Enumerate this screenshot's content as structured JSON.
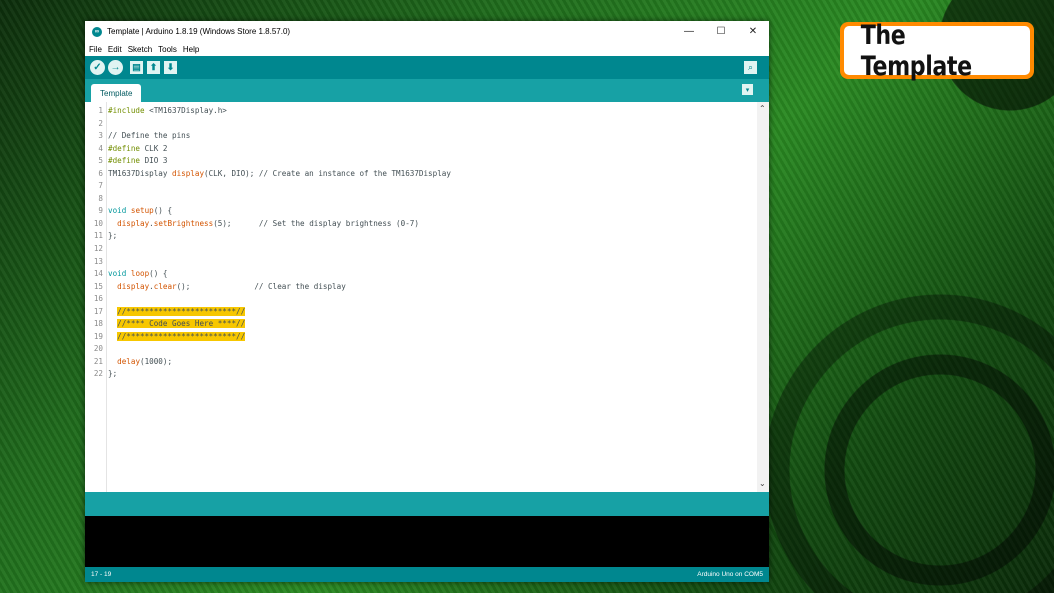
{
  "window": {
    "title": "Template | Arduino 1.8.19 (Windows Store 1.8.57.0)",
    "controls": {
      "minimize": "—",
      "maximize": "☐",
      "close": "✕"
    }
  },
  "menu": [
    "File",
    "Edit",
    "Sketch",
    "Tools",
    "Help"
  ],
  "toolbar": {
    "verify_glyph": "✓",
    "upload_glyph": "→",
    "new_glyph": "▤",
    "open_glyph": "⬆",
    "save_glyph": "⬇",
    "serial_glyph": "⌕"
  },
  "tabs": [
    {
      "label": "Template"
    }
  ],
  "tab_menu_glyph": "▾",
  "code_lines": [
    "1",
    "2",
    "3",
    "4",
    "5",
    "6",
    "7",
    "8",
    "9",
    "10",
    "11",
    "12",
    "13",
    "14",
    "15",
    "16",
    "17",
    "18",
    "19",
    "20",
    "21",
    "22"
  ],
  "code": {
    "l1a": "#include",
    "l1b": " <TM1637Display.h>",
    "l3": "// Define the pins",
    "l4a": "#define",
    "l4b": " CLK 2",
    "l5a": "#define",
    "l5b": " DIO 3",
    "l6a": "TM1637Display ",
    "l6b": "display",
    "l6c": "(CLK, DIO); // Create an instance of the TM1637Display",
    "l9a": "void",
    "l9b": " ",
    "l9c": "setup",
    "l9d": "() {",
    "l10a": "  ",
    "l10b": "display",
    "l10c": ".",
    "l10d": "setBrightness",
    "l10e": "(5);      // Set the display brightness (0-7)",
    "l11": "};",
    "l14a": "void",
    "l14b": " ",
    "l14c": "loop",
    "l14d": "() {",
    "l15a": "  ",
    "l15b": "display",
    "l15c": ".",
    "l15d": "clear",
    "l15e": "();              // Clear the display",
    "l17a": "  ",
    "l17b": "//************************//",
    "l18a": "  ",
    "l18b": "//**** Code Goes Here ****//",
    "l19a": "  ",
    "l19b": "//************************//",
    "l21a": "  ",
    "l21b": "delay",
    "l21c": "(1000);",
    "l22": "};"
  },
  "scroll": {
    "up": "⌃",
    "down": "⌄"
  },
  "status": {
    "line_range": "17 - 19",
    "board": "Arduino Uno on COM5"
  },
  "overlay": {
    "badge_text": "The Template"
  },
  "colors": {
    "teal_dark": "#00878f",
    "teal_light": "#17a1a5",
    "highlight": "#f7c700",
    "badge_orange": "#ff8a00"
  }
}
